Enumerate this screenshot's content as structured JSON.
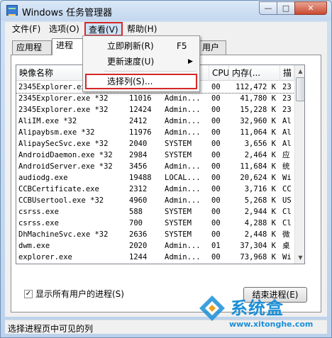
{
  "window": {
    "title": "Windows 任务管理器",
    "min_symbol": "—",
    "max_symbol": "□",
    "close_symbol": "✕"
  },
  "menu": {
    "file": "文件(F)",
    "options": "选项(O)",
    "view": "查看(V)",
    "help": "帮助(H)"
  },
  "view_menu": {
    "refresh_now": "立即刷新(R)",
    "refresh_shortcut": "F5",
    "update_speed": "更新速度(U)",
    "select_columns": "选择列(S)..."
  },
  "tabs": {
    "applications": "应用程序",
    "processes": "进程",
    "users": "用户"
  },
  "columns": {
    "image_name": "映像名称",
    "cpu": "CPU",
    "memory": "内存(...",
    "description": "描"
  },
  "processes": [
    {
      "name": "2345Explorer.exe *32",
      "pid": "",
      "user": "",
      "cpu": "00",
      "mem": "112,472 K",
      "desc": "23"
    },
    {
      "name": "2345Explorer.exe *32",
      "pid": "11016",
      "user": "Admin...",
      "cpu": "00",
      "mem": "41,780 K",
      "desc": "23"
    },
    {
      "name": "2345Explorer.exe *32",
      "pid": "12424",
      "user": "Admin...",
      "cpu": "00",
      "mem": "15,228 K",
      "desc": "23"
    },
    {
      "name": "AliIM.exe *32",
      "pid": "2412",
      "user": "Admin...",
      "cpu": "00",
      "mem": "32,960 K",
      "desc": "Al"
    },
    {
      "name": "Alipaybsm.exe *32",
      "pid": "11976",
      "user": "Admin...",
      "cpu": "00",
      "mem": "11,064 K",
      "desc": "Al"
    },
    {
      "name": "AlipaySecSvc.exe *32",
      "pid": "2040",
      "user": "SYSTEM",
      "cpu": "00",
      "mem": "3,656 K",
      "desc": "Al"
    },
    {
      "name": "AndroidDaemon.exe *32",
      "pid": "2984",
      "user": "SYSTEM",
      "cpu": "00",
      "mem": "2,464 K",
      "desc": "应"
    },
    {
      "name": "AndroidServer.exe *32",
      "pid": "3456",
      "user": "Admin...",
      "cpu": "00",
      "mem": "11,684 K",
      "desc": "统"
    },
    {
      "name": "audiodg.exe",
      "pid": "19488",
      "user": "LOCAL...",
      "cpu": "00",
      "mem": "20,624 K",
      "desc": "Wi"
    },
    {
      "name": "CCBCertificate.exe",
      "pid": "2312",
      "user": "Admin...",
      "cpu": "00",
      "mem": "3,716 K",
      "desc": "CC"
    },
    {
      "name": "CCBUsertool.exe *32",
      "pid": "4960",
      "user": "Admin...",
      "cpu": "00",
      "mem": "5,268 K",
      "desc": "US"
    },
    {
      "name": "csrss.exe",
      "pid": "588",
      "user": "SYSTEM",
      "cpu": "00",
      "mem": "2,944 K",
      "desc": "Cl"
    },
    {
      "name": "csrss.exe",
      "pid": "700",
      "user": "SYSTEM",
      "cpu": "00",
      "mem": "4,288 K",
      "desc": "Cl"
    },
    {
      "name": "DhMachineSvc.exe *32",
      "pid": "2636",
      "user": "SYSTEM",
      "cpu": "00",
      "mem": "2,448 K",
      "desc": "微"
    },
    {
      "name": "dwm.exe",
      "pid": "2020",
      "user": "Admin...",
      "cpu": "01",
      "mem": "37,304 K",
      "desc": "桌"
    },
    {
      "name": "explorer.exe",
      "pid": "1244",
      "user": "Admin...",
      "cpu": "00",
      "mem": "73,968 K",
      "desc": "Wi"
    }
  ],
  "show_all_users": "显示所有用户的进程(S)",
  "show_all_checked": "✓",
  "end_process": "结束进程(E)",
  "status_text": "选择进程页中可见的列",
  "watermark": {
    "name": "系统盒",
    "url": "www.xitonghe.com"
  },
  "icons": {
    "submenu_arrow": "▶",
    "scroll_up": "▲",
    "scroll_down": "▼"
  }
}
